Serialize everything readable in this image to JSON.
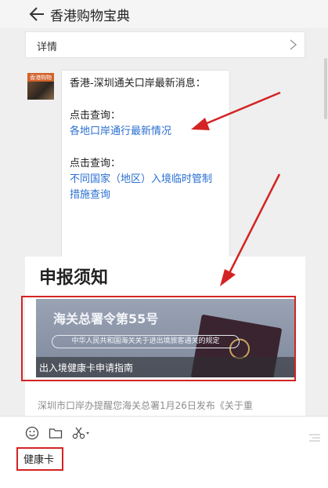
{
  "header": {
    "title": "香港购物宝典"
  },
  "detail_bar": {
    "label": "详情"
  },
  "avatar": {
    "text": "香港购物"
  },
  "message": {
    "line1": "香港-深圳通关口岸最新消息：",
    "query1_prompt": "点击查询：",
    "query1_link": "各地口岸通行最新情况",
    "query2_prompt": "点击查询：",
    "query2_link_line1": "不同国家（地区）入境临时管制",
    "query2_link_line2": "措施查询"
  },
  "article": {
    "heading": "申报须知",
    "banner_title": "海关总署令第55号",
    "banner_subtitle": "中华人民共和国海关关于进出境旅客通关的规定",
    "caption": "出入境健康卡申请指南",
    "excerpt": "深圳市口岸办提醒您海关总署1月26日发布《关于重"
  },
  "input": {
    "text": "健康卡"
  },
  "icons": {
    "back": "back-arrow-icon",
    "chevron": "chevron-right-icon",
    "emoji": "emoji-icon",
    "folder": "folder-icon",
    "scissors": "scissors-icon",
    "scroll": "scroll-to-bottom-icon"
  },
  "colors": {
    "link": "#2a6fd1",
    "annotation": "#d42323"
  }
}
